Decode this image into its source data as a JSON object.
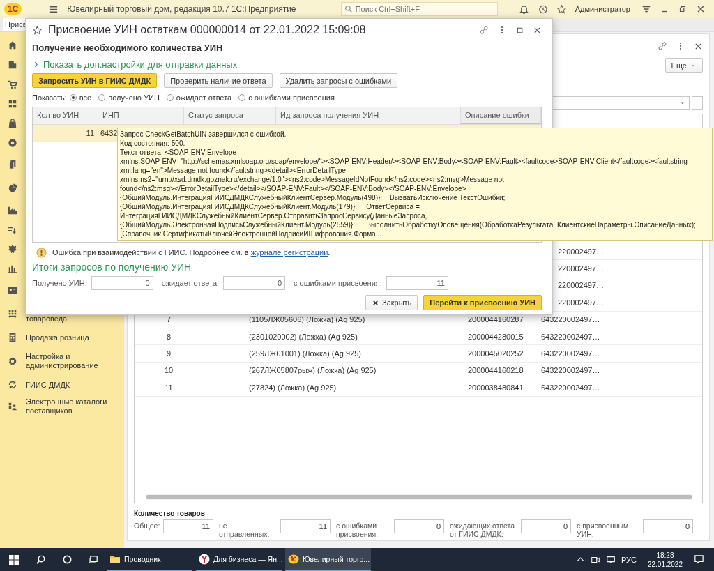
{
  "top_bar": {
    "logo": "1С",
    "title": "Ювелирный торговый дом, редакция 10.7 1С:Предприятие",
    "search": {
      "placeholder": "Поиск Ctrl+Shift+F"
    },
    "user": "Администратор"
  },
  "open_tabs": [
    {
      "label": "Присв",
      "selected": true
    }
  ],
  "sidebar": {
    "items": [
      {
        "kind": "icon"
      },
      {
        "kind": "icon"
      },
      {
        "kind": "icon"
      },
      {
        "kind": "icon"
      },
      {
        "kind": "icon"
      },
      {
        "kind": "icon"
      },
      {
        "kind": "icon"
      },
      {
        "kind": "icon"
      },
      {
        "kind": "icon"
      },
      {
        "kind": "icon"
      },
      {
        "kind": "icon"
      },
      {
        "kind": "icon"
      },
      {
        "kind": "icon"
      },
      {
        "kind": "labeled",
        "label": "товароведа"
      },
      {
        "kind": "labeled",
        "label": "Продажа розница"
      },
      {
        "kind": "labeled",
        "label": "Настройка и администрирование"
      },
      {
        "kind": "labeled",
        "label": "ГИИС ДМДК"
      },
      {
        "kind": "labeled",
        "label": "Электронные каталоги поставщиков"
      }
    ]
  },
  "main_form": {
    "more_button": "Еще",
    "table": {
      "rows": [
        {
          "uin": "220002497…"
        },
        {
          "uin": "220002497…"
        },
        {
          "uin": "220002497…"
        },
        {
          "uin": "220002497…"
        },
        {
          "number": "7",
          "name": "(1105ЛЖ05606) (Ложка) (Ag 925)",
          "barcode": "2000044160287",
          "uin": "643220002497…"
        },
        {
          "number": "8",
          "name": "(2301020002) (Ложка) (Ag 925)",
          "barcode": "2000044280015",
          "uin": "643220002497…"
        },
        {
          "number": "9",
          "name": "(259ЛЖ01001) (Ложка) (Ag 925)",
          "barcode": "2000045020252",
          "uin": "643220002497…"
        },
        {
          "number": "10",
          "name": "(267ЛЖ05807рыж) (Ложка) (Ag 925)",
          "barcode": "2000044160218",
          "uin": "643220002497…"
        },
        {
          "number": "11",
          "name": "(27824) (Ложка) (Ag 925)",
          "barcode": "2000038480841",
          "uin": "643220002497…"
        }
      ]
    },
    "totals": {
      "title": "Количество товаров",
      "fields": [
        {
          "label": "Общее:",
          "value": "11"
        },
        {
          "label": "не отправленных:",
          "value": "11"
        },
        {
          "label": "с ошибками присвоения:",
          "value": "0"
        },
        {
          "label": "ожидающих ответа от ГИИС ДМДК:",
          "value": "0"
        },
        {
          "label": "с присвоенным УИН:",
          "value": "0"
        }
      ]
    }
  },
  "dialog": {
    "title": "Присвоение УИН остаткам 000000014 от 22.01.2022 15:09:08",
    "heading": "Получение необходимого количества УИН",
    "expander": {
      "label": "Показать доп.настройки для отправки данных",
      "expanded": false
    },
    "buttons": [
      {
        "label": "Запросить УИН в ГИИС ДМДК",
        "default": true
      },
      {
        "label": "Проверить наличие ответа",
        "default": false
      },
      {
        "label": "Удалить запросы с ошибками",
        "default": false
      }
    ],
    "filter": {
      "label": "Показать:",
      "options": [
        {
          "label": "все",
          "selected": true
        },
        {
          "label": "получено УИН",
          "selected": false
        },
        {
          "label": "ожидает ответа",
          "selected": false
        },
        {
          "label": "с ошибками присвоения",
          "selected": false
        }
      ]
    },
    "table": {
      "columns": [
        "Кол-во УИН",
        "ИНП",
        "Статус запроса",
        "Ид запроса получения УИН",
        "Описание ошибки"
      ],
      "rows": [
        {
          "count": "11",
          "inn": "6432",
          "selected": true
        }
      ]
    },
    "warning": {
      "text": "Ошибка при взаимодействии с ГИИС. Подробнее см. в ",
      "link": "журнале регистрации",
      "after": "."
    },
    "totals_title": "Итоги запросов по получению УИН",
    "totals": [
      {
        "label": "Получено УИН:",
        "value": "0"
      },
      {
        "label": "ожидает ответа:",
        "value": "0"
      },
      {
        "label": "с ошибками присвоения:",
        "value": "11"
      }
    ],
    "footer_buttons": [
      {
        "label": "Закрыть",
        "kind": "close"
      },
      {
        "label": "Перейти к присвоению УИН",
        "kind": "default"
      }
    ]
  },
  "tooltip": {
    "text": "Запрос CheckGetBatchUIN завершился с ошибкой.\nКод состояния: 500.\nТекст ответа: <SOAP-ENV:Envelope\nxmlns:SOAP-ENV=\"http://schemas.xmlsoap.org/soap/envelope/\"><SOAP-ENV:Header/><SOAP-ENV:Body><SOAP-ENV:Fault><faultcode>SOAP-ENV:Client</faultcode><faultstring\nxml:lang=\"en\">Message not found</faultstring><detail><ErrorDetailType\nxmlns:ns2=\"urn://xsd.dmdk.goznak.ru/exchange/1.0\"><ns2:code>MessageIdNotFound</ns2:code><ns2:msg>Message not\nfound</ns2:msg></ErrorDetailType></detail></SOAP-ENV:Fault></SOAP-ENV:Body></SOAP-ENV:Envelope>\n{ОбщийМодуль.ИнтеграцияГИИСДМДКСлужебныйКлиентСервер.Модуль(498)}:\tВызватьИсключение ТекстОшибки;\n{ОбщийМодуль.ИнтеграцияГИИСДМДКСлужебныйКлиент.Модуль(179)}:\tОтветСервиса =\nИнтеграцияГИИСДМДКСлужебныйКлиентСервер.ОтправитьЗапросСервису(ДанныеЗапроса,\n{ОбщийМодуль.ЭлектроннаяПодписьСлужебныйКлиент.Модуль(2559)}:\tВыполнитьОбработкуОповещения(ОбработкаРезультата, КлиентскиеПараметры.ОписаниеДанных);\n{Справочник.СертификатыКлючейЭлектроннойПодписиИШифрования.Форма...."
  },
  "taskbar": {
    "apps": [
      {
        "label": "Проводник",
        "selected": false
      },
      {
        "label": "Для бизнеса — Ян...",
        "selected": false
      },
      {
        "label": "Ювелирный торго...",
        "selected": true
      }
    ],
    "language": "РУС",
    "time": "18:28",
    "date": "22.01.2022"
  }
}
